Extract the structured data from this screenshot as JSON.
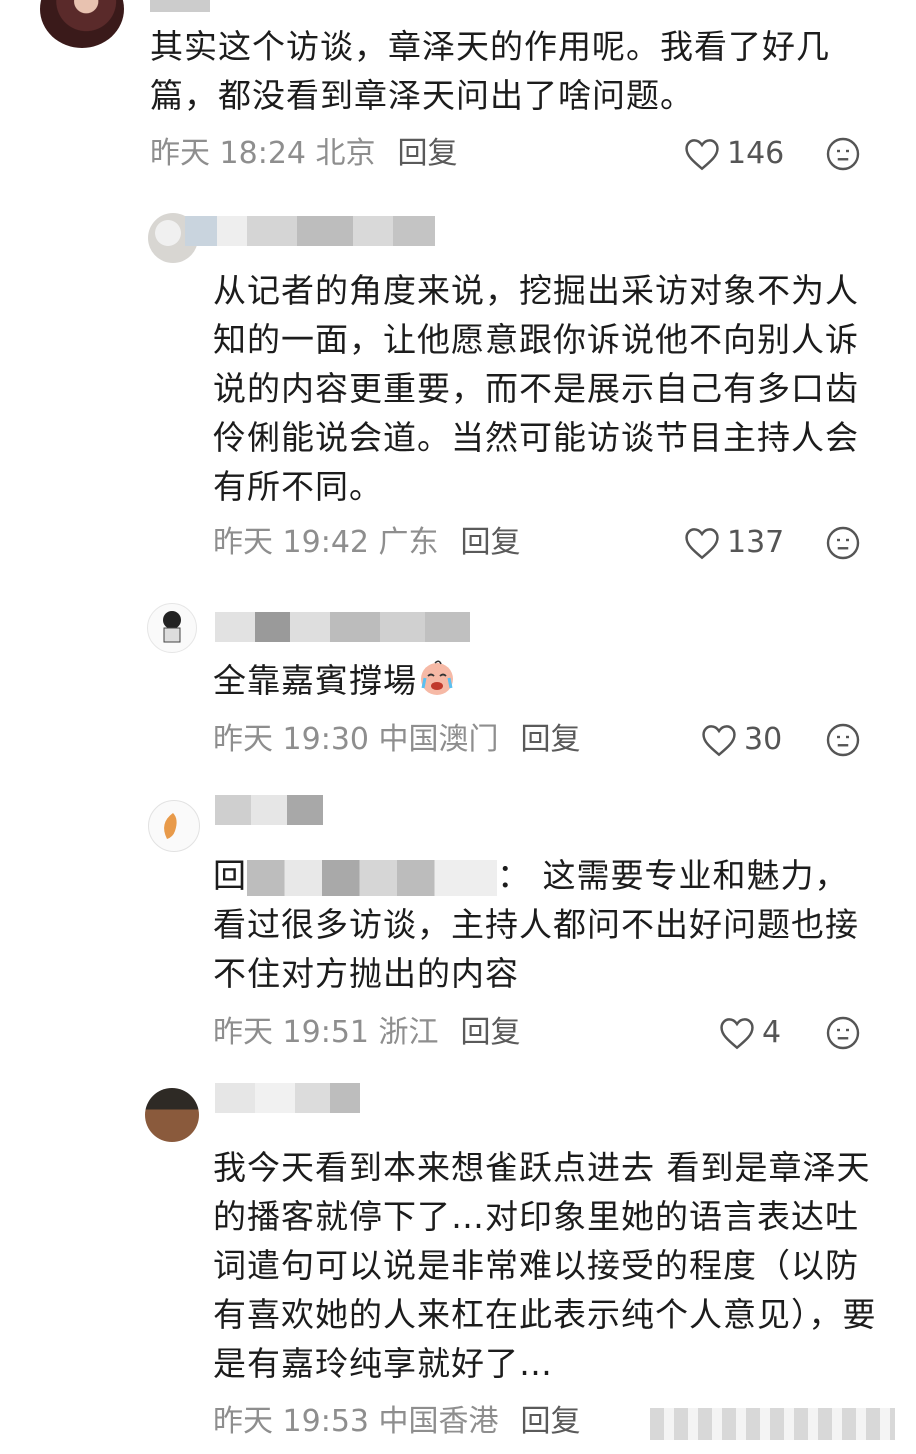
{
  "comments": [
    {
      "text": "其实这个访谈，章泽天的作用呢。我看了好几篇，都没看到章泽天问出了啥问题。",
      "time": "昨天 18:24 北京",
      "reply": "回复",
      "likes": "146"
    },
    {
      "text": "从记者的角度来说，挖掘出采访对象不为人知的一面，让他愿意跟你诉说他不向别人诉说的内容更重要，而不是展示自己有多口齿伶俐能说会道。当然可能访谈节目主持人会有所不同。",
      "time": "昨天 19:42 广东",
      "reply": "回复",
      "likes": "137"
    },
    {
      "text": "全靠嘉賓撐場",
      "emoji": "crying-face-emoji",
      "time": "昨天 19:30 中国澳门",
      "reply": "回复",
      "likes": "30"
    },
    {
      "text_prefix": "回",
      "text_after": "：  这需要专业和魅力，看过很多访谈，主持人都问不出好问题也接不住对方抛出的内容",
      "time": "昨天 19:51 浙江",
      "reply": "回复",
      "likes": "4"
    },
    {
      "text": "我今天看到本来想雀跃点进去 看到是章泽天的播客就停下了…对印象里她的语言表达吐词遣句可以说是非常难以接受的程度（以防有喜欢她的人来杠在此表示纯个人意见），要是有嘉玲纯享就好了…",
      "time": "昨天 19:53 中国香港",
      "reply": "回复"
    }
  ],
  "icons": {
    "like": "heart-outline-icon",
    "react": "emoji-face-icon"
  },
  "colors": {
    "meta": "#8e8e8e",
    "text": "#1c1c1c",
    "blur": "#d0d0d0"
  }
}
